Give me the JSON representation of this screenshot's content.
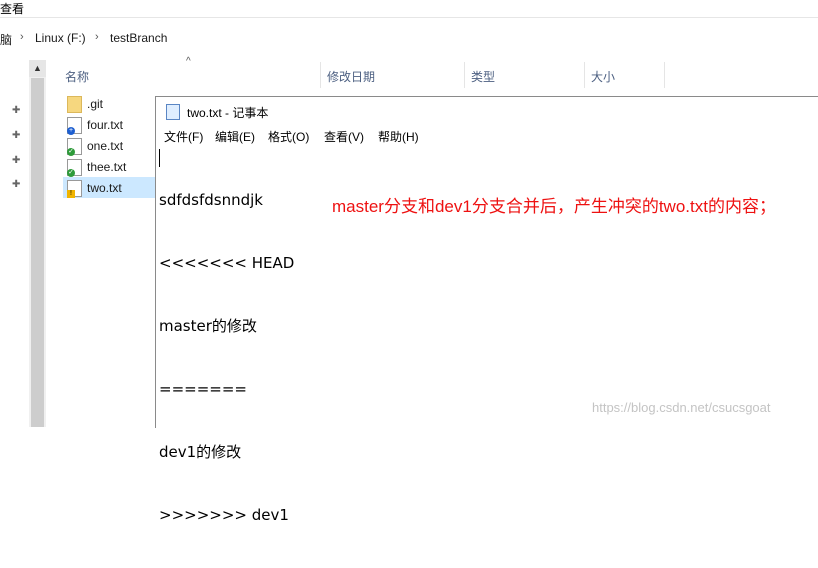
{
  "ribbon": {
    "view_label": "查看"
  },
  "address": {
    "prefix": "脑",
    "drive": "Linux (F:)",
    "folder": "testBranch"
  },
  "columns": {
    "name": "名称",
    "modified": "修改日期",
    "type": "类型",
    "size": "大小"
  },
  "files": [
    {
      "name": ".git",
      "icon": "folder-icon"
    },
    {
      "name": "four.txt",
      "icon": "text-file-blue-badge-icon"
    },
    {
      "name": "one.txt",
      "icon": "text-file-green-check-icon"
    },
    {
      "name": "thee.txt",
      "icon": "text-file-green-check-icon"
    },
    {
      "name": "two.txt",
      "icon": "text-file-conflict-icon",
      "selected": true
    }
  ],
  "notepad": {
    "title": "two.txt - 记事本",
    "menu": [
      "文件(F)",
      "编辑(E)",
      "格式(O)",
      "查看(V)",
      "帮助(H)"
    ],
    "lines": [
      "sdfdsfdsnndjk",
      "<<<<<<< HEAD",
      "master的修改",
      "=======",
      "dev1的修改",
      ">>>>>>> dev1"
    ]
  },
  "annotation": "master分支和dev1分支合并后，产生冲突的two.txt的内容；",
  "watermark": "https://blog.csdn.net/csucsgoat",
  "colors": {
    "annotation": "#ee1111",
    "selection": "#cce8ff",
    "header_text": "#4d6082"
  }
}
